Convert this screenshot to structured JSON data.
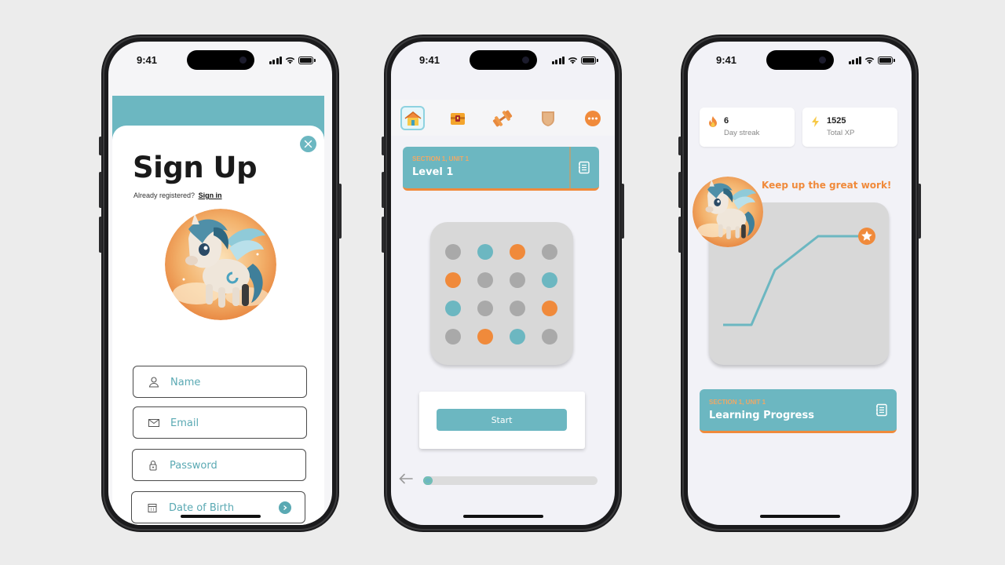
{
  "status_time": "9:41",
  "signup": {
    "title": "Sign Up",
    "already_text": "Already registered?",
    "signin_link": "Sign in",
    "fields": {
      "name_placeholder": "Name",
      "email_placeholder": "Email",
      "password_placeholder": "Password",
      "dob_placeholder": "Date of Birth"
    }
  },
  "lesson": {
    "nav_icons": [
      "home-icon",
      "treasure-chest-icon",
      "dumbbell-icon",
      "shield-icon",
      "more-icon"
    ],
    "section": "SECTION 1, UNIT 1",
    "title": "Level 1",
    "start_label": "Start",
    "progress_fraction": 0.03,
    "dot_grid": [
      [
        "gray",
        "teal",
        "orange",
        "gray"
      ],
      [
        "orange",
        "gray",
        "gray",
        "teal"
      ],
      [
        "teal",
        "gray",
        "gray",
        "orange"
      ],
      [
        "gray",
        "orange",
        "teal",
        "gray"
      ]
    ]
  },
  "progress_screen": {
    "streak_value": "6",
    "streak_label": "Day streak",
    "xp_value": "1525",
    "xp_label": "Total XP",
    "encouragement": "Keep up the great work!",
    "section": "SECTION 1, UNIT 1",
    "title": "Learning Progress"
  },
  "colors": {
    "teal": "#6cb7c1",
    "orange": "#f08a3b",
    "gray_dot": "#a9a9a9"
  }
}
